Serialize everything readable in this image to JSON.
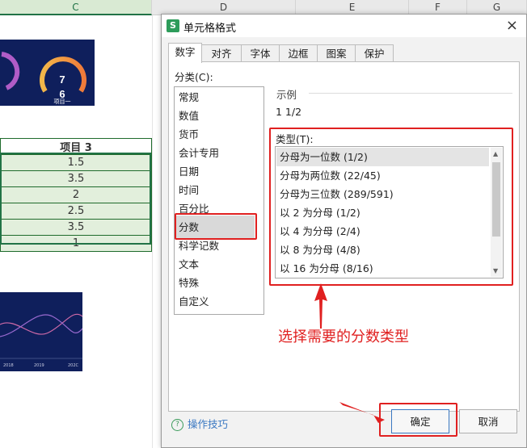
{
  "sheet": {
    "columns": [
      "C",
      "D",
      "E",
      "F",
      "G"
    ],
    "table_header": "项目 3",
    "table_values": [
      "1.5",
      "3.5",
      "2",
      "2.5",
      "3.5",
      "1"
    ],
    "gauge_value_top": "7",
    "gauge_value_bottom": "6",
    "gauge_label": "项目一",
    "chart_x_labels": [
      "2018",
      "2019",
      "202C"
    ]
  },
  "dialog": {
    "title": "单元格格式",
    "app_icon": "S",
    "close_glyph": "×",
    "tabs": [
      "数字",
      "对齐",
      "字体",
      "边框",
      "图案",
      "保护"
    ],
    "active_tab": "数字",
    "category_label": "分类(C):",
    "categories": [
      "常规",
      "数值",
      "货币",
      "会计专用",
      "日期",
      "时间",
      "百分比",
      "分数",
      "科学记数",
      "文本",
      "特殊",
      "自定义"
    ],
    "selected_category": "分数",
    "sample_label": "示例",
    "sample_value": "1 1/2",
    "type_label": "类型(T):",
    "types": [
      "分母为一位数 (1/2)",
      "分母为两位数 (22/45)",
      "分母为三位数 (289/591)",
      "以 2 为分母 (1/2)",
      "以 4 为分母 (2/4)",
      "以 8 为分母 (4/8)",
      "以 16 为分母 (8/16)"
    ],
    "selected_type": "分母为一位数 (1/2)",
    "annotation": "选择需要的分数类型",
    "tips_label": "操作技巧",
    "ok_label": "确定",
    "cancel_label": "取消"
  },
  "colors": {
    "annotation_red": "#e02020",
    "selection_green": "#217346",
    "dashboard_navy": "#0f1f5c",
    "link_blue": "#3a78c2"
  }
}
